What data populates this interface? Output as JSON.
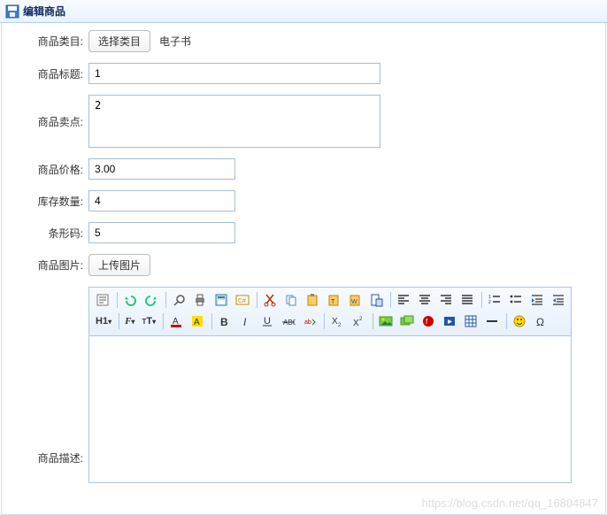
{
  "header": {
    "title": "编辑商品"
  },
  "form": {
    "category": {
      "label": "商品类目:",
      "button": "选择类目",
      "value": "电子书"
    },
    "title": {
      "label": "商品标题:",
      "value": "1"
    },
    "sellpoint": {
      "label": "商品卖点:",
      "value": "2"
    },
    "price": {
      "label": "商品价格:",
      "value": "3.00"
    },
    "stock": {
      "label": "库存数量:",
      "value": "4"
    },
    "barcode": {
      "label": "条形码:",
      "value": "5"
    },
    "image": {
      "label": "商品图片:",
      "button": "上传图片"
    },
    "desc": {
      "label": "商品描述:"
    }
  },
  "editor_toolbar_row1": [
    "source",
    "sep",
    "undo",
    "redo",
    "sep",
    "preview",
    "print",
    "template",
    "code",
    "sep",
    "cut",
    "copy",
    "paste",
    "paste-text",
    "paste-word",
    "insert-file",
    "sep",
    "align-left",
    "align-center",
    "align-right",
    "align-justify",
    "sep",
    "ordered-list",
    "unordered-list",
    "indent",
    "outdent"
  ],
  "editor_toolbar_row2": [
    "heading",
    "sep",
    "font",
    "font-size",
    "sep",
    "text-color",
    "bg-color",
    "sep",
    "bold",
    "italic",
    "underline",
    "strike",
    "abc",
    "sep",
    "subscript",
    "superscript",
    "sep",
    "picture",
    "multi-picture",
    "flash",
    "media",
    "table",
    "hr",
    "sep",
    "smiley",
    "special-char"
  ],
  "watermark": "https://blog.csdn.net/qq_16804847"
}
